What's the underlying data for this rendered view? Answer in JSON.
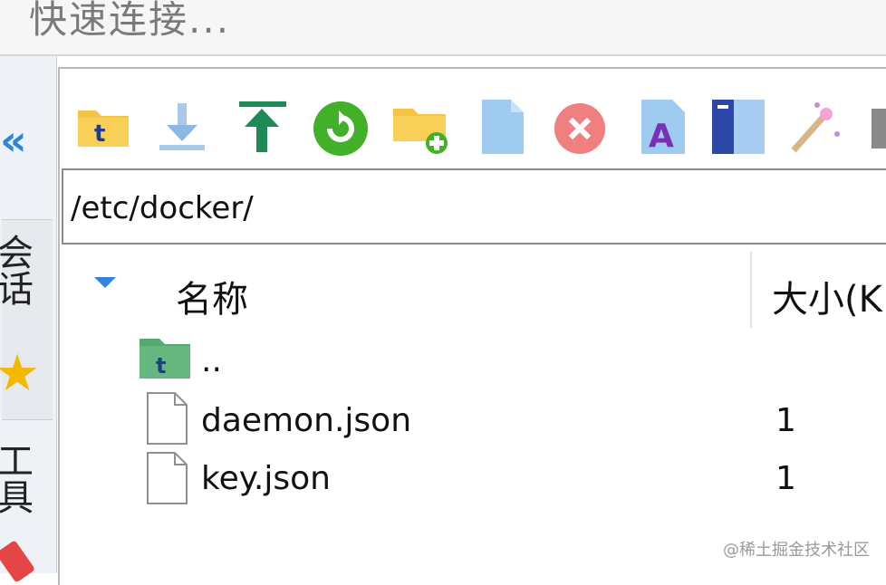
{
  "header": {
    "quick_connect": "快速连接..."
  },
  "sidebar": {
    "collapse_glyph": "«",
    "tabs": [
      {
        "label": "会话",
        "icon": "star-icon"
      },
      {
        "label": "工具",
        "icon": "pen-icon"
      }
    ]
  },
  "toolbar": {
    "buttons": [
      {
        "name": "parent-folder-button",
        "icon": "folder-up-icon"
      },
      {
        "name": "download-button",
        "icon": "download-icon"
      },
      {
        "name": "upload-button",
        "icon": "upload-icon"
      },
      {
        "name": "refresh-button",
        "icon": "refresh-icon"
      },
      {
        "name": "new-folder-button",
        "icon": "new-folder-icon"
      },
      {
        "name": "new-file-button",
        "icon": "new-file-icon"
      },
      {
        "name": "delete-button",
        "icon": "delete-icon"
      },
      {
        "name": "rename-button",
        "icon": "rename-icon"
      },
      {
        "name": "split-view-button",
        "icon": "split-view-icon"
      },
      {
        "name": "magic-button",
        "icon": "magic-wand-icon"
      }
    ]
  },
  "path": {
    "value": "/etc/docker/"
  },
  "table": {
    "columns": {
      "name": "名称",
      "size": "大小(K"
    },
    "rows": [
      {
        "name": "..",
        "size": "",
        "icon": "parent-folder-icon"
      },
      {
        "name": "daemon.json",
        "size": "1",
        "icon": "file-icon"
      },
      {
        "name": "key.json",
        "size": "1",
        "icon": "file-icon"
      }
    ]
  },
  "watermark": "@稀土掘金技术社区",
  "colors": {
    "accent": "#2f86d8",
    "star": "#f5b800",
    "folder": "#f6c445"
  }
}
